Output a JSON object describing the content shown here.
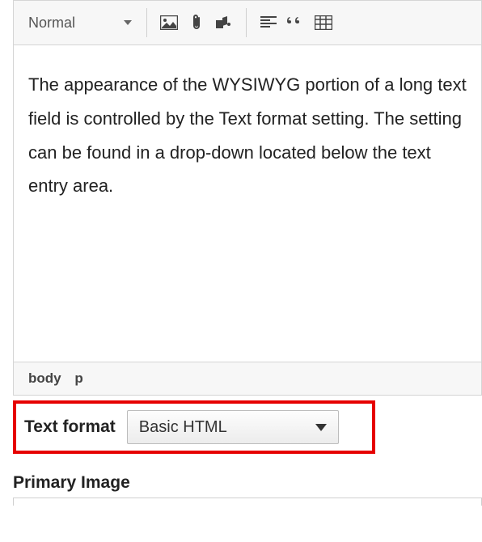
{
  "toolbar": {
    "format_select_value": "Normal"
  },
  "content": {
    "text": "The appearance of the WYSIWYG portion of a long text field is controlled by the Text format setting. The setting can be found in a drop-down located below the text entry area."
  },
  "statusbar": {
    "path1": "body",
    "path2": "p"
  },
  "text_format": {
    "label": "Text format",
    "value": "Basic HTML"
  },
  "primary_image": {
    "label": "Primary Image"
  }
}
